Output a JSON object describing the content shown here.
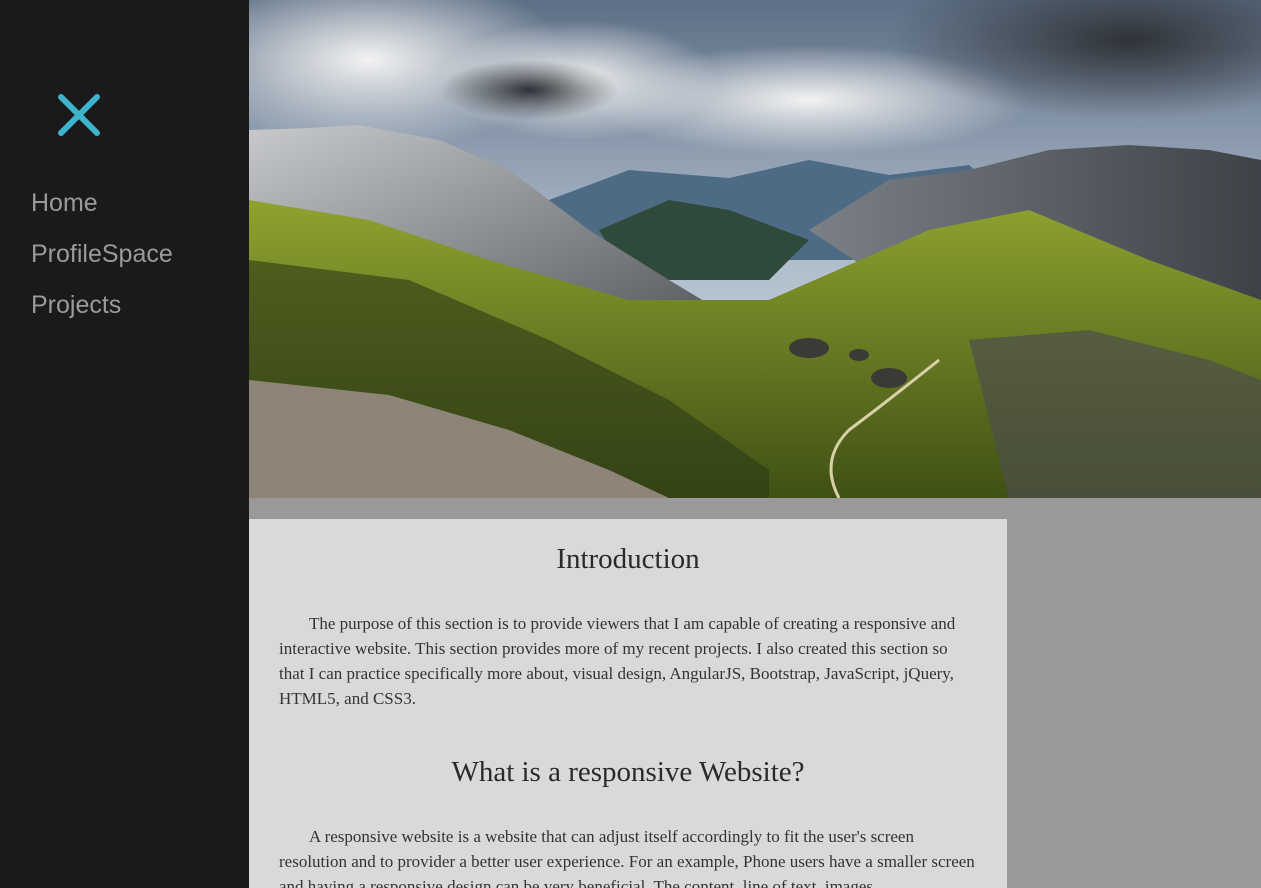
{
  "sidebar": {
    "close_icon": "close-x-icon",
    "accent": "#3cb4cc",
    "items": [
      {
        "label": "Home"
      },
      {
        "label": "ProfileSpace"
      },
      {
        "label": "Projects"
      }
    ]
  },
  "hero": {
    "image": "mountain-valley-landscape"
  },
  "content": {
    "intro_title": "Introduction",
    "intro_text": "The purpose of this section is to provide viewers that I am capable of creating a responsive and interactive website. This section provides more of my recent projects. I also created this section so that I can practice specifically more about, visual design, AngularJS, Bootstrap, JavaScript, jQuery, HTML5, and CSS3.",
    "responsive_title": "What is a responsive Website?",
    "responsive_text": "A responsive website is a website that can adjust itself accordingly to fit the user's screen resolution and to provider a better user experience. For an example, Phone users have a smaller screen and having a responsive design can be very beneficial. The content, line of text, images"
  }
}
